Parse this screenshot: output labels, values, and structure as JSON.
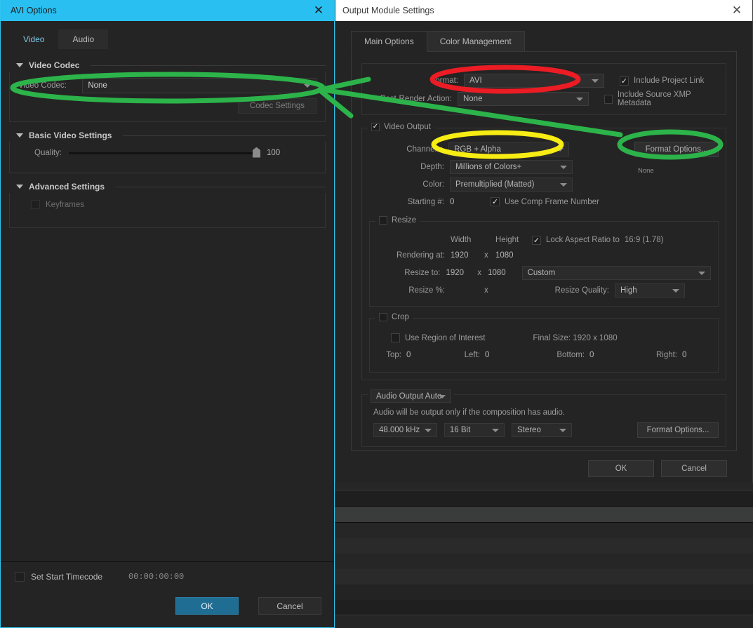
{
  "avi_dialog": {
    "title": "AVI Options",
    "close_icon": "close-icon",
    "tabs": [
      {
        "label": "Video",
        "active": true
      },
      {
        "label": "Audio",
        "active": false
      }
    ],
    "sections": {
      "video_codec": {
        "title": "Video Codec",
        "codec_label": "Video Codec:",
        "codec_value": "None",
        "codec_settings_button": "Codec Settings"
      },
      "basic_video_settings": {
        "title": "Basic Video Settings",
        "quality_label": "Quality:",
        "quality_value": "100"
      },
      "advanced_settings": {
        "title": "Advanced Settings",
        "keyframes_label": "Keyframes",
        "keyframes_checked": false
      }
    },
    "footer": {
      "set_start_timecode_label": "Set Start Timecode",
      "set_start_timecode_checked": false,
      "timecode_value": "00:00:00:00",
      "ok_label": "OK",
      "cancel_label": "Cancel"
    }
  },
  "oms_dialog": {
    "title": "Output Module Settings",
    "close_icon": "close-icon",
    "tabs": [
      {
        "label": "Main Options",
        "active": true
      },
      {
        "label": "Color Management",
        "active": false
      }
    ],
    "format_group": {
      "format_label": "Format:",
      "format_value": "AVI",
      "post_render_label": "Post-Render Action:",
      "post_render_value": "None",
      "include_project_link_label": "Include Project Link",
      "include_project_link_checked": true,
      "include_xmp_label": "Include Source XMP Metadata",
      "include_xmp_checked": false
    },
    "video_output": {
      "legend": "Video Output",
      "legend_checked": true,
      "channels_label": "Channels:",
      "channels_value": "RGB + Alpha",
      "depth_label": "Depth:",
      "depth_value": "Millions of Colors+",
      "color_label": "Color:",
      "color_value": "Premultiplied (Matted)",
      "starting_label": "Starting #:",
      "starting_value": "0",
      "use_comp_frame_label": "Use Comp Frame Number",
      "use_comp_frame_checked": true,
      "format_options_button": "Format Options...",
      "format_options_status": "None"
    },
    "resize": {
      "legend": "Resize",
      "legend_checked": false,
      "width_header": "Width",
      "height_header": "Height",
      "lock_aspect_label": "Lock Aspect Ratio to",
      "lock_aspect_value": "16:9 (1.78)",
      "lock_aspect_checked": true,
      "rendering_at_label": "Rendering at:",
      "rendering_at_width": "1920",
      "rendering_at_height": "1080",
      "resize_to_label": "Resize to:",
      "resize_to_width": "1920",
      "resize_to_height": "1080",
      "resize_preset_value": "Custom",
      "resize_pct_label": "Resize %:",
      "x_separator": "x",
      "resize_quality_label": "Resize Quality:",
      "resize_quality_value": "High"
    },
    "crop": {
      "legend": "Crop",
      "legend_checked": false,
      "use_region_label": "Use Region of Interest",
      "use_region_checked": false,
      "final_size_label": "Final Size: 1920 x 1080",
      "top_label": "Top:",
      "top_value": "0",
      "left_label": "Left:",
      "left_value": "0",
      "bottom_label": "Bottom:",
      "bottom_value": "0",
      "right_label": "Right:",
      "right_value": "0"
    },
    "audio_output": {
      "mode_value": "Audio Output Auto",
      "note": "Audio will be output only if the composition has audio.",
      "rate_value": "48.000 kHz",
      "depth_value": "16 Bit",
      "channels_value": "Stereo",
      "format_options_button": "Format Options..."
    },
    "footer": {
      "ok_label": "OK",
      "cancel_label": "Cancel"
    }
  },
  "annotations": {
    "red_ellipse_target": "format-dropdown",
    "yellow_ellipse_target": "channels-dropdown",
    "green_ellipse_targets": [
      "video-codec-dropdown",
      "format-options-button"
    ],
    "green_arrow": "points from Format Options button to Video Codec dropdown",
    "colors": {
      "red": "#ec1c24",
      "yellow": "#f7ec13",
      "green": "#2cb34a",
      "accent_blue": "#29c0f1",
      "button_blue": "#1f6d93"
    }
  }
}
